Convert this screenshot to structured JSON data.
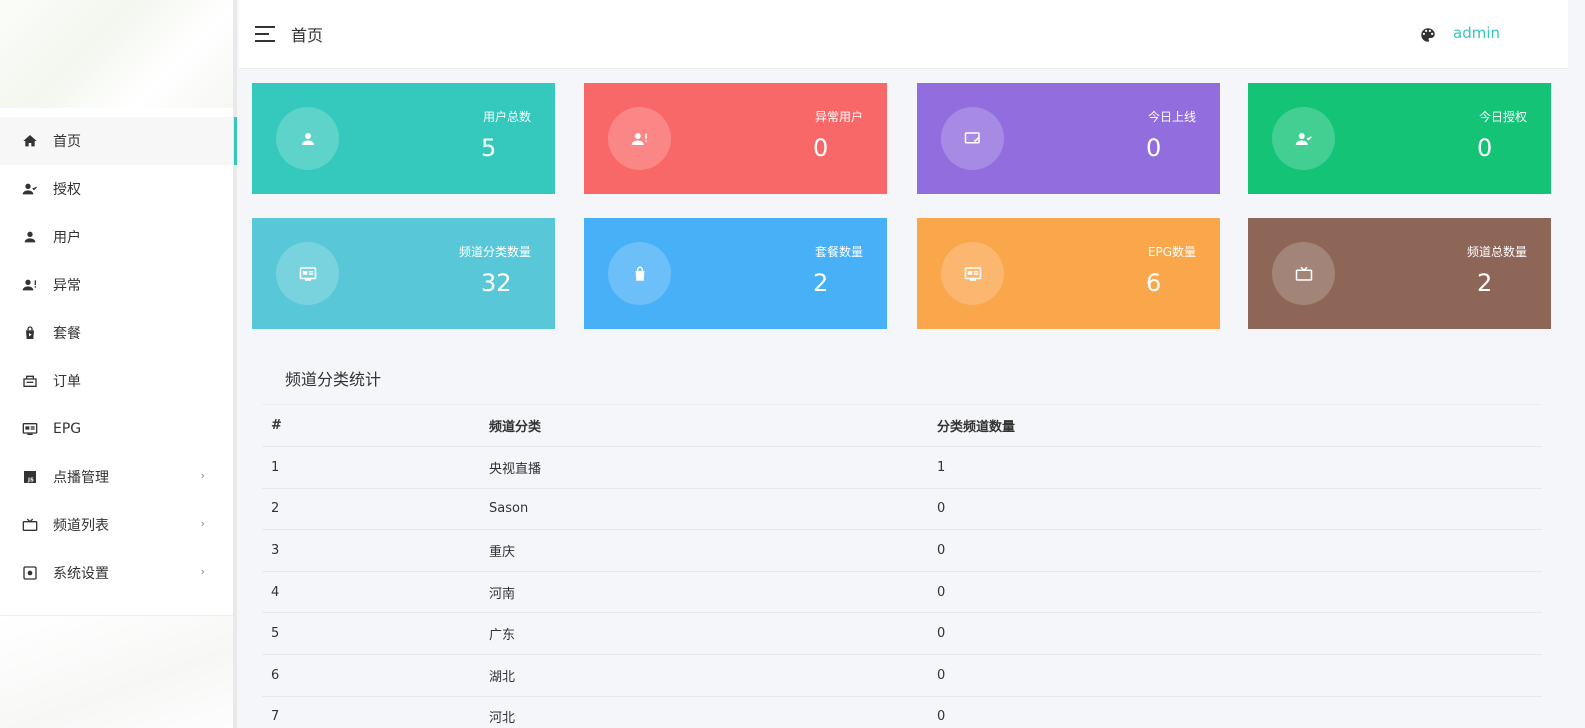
{
  "header": {
    "title": "首页",
    "user": "admin"
  },
  "sidebar": {
    "items": [
      {
        "label": "首页",
        "icon": "home-icon",
        "active": true,
        "has_children": false
      },
      {
        "label": "授权",
        "icon": "user-check-icon",
        "active": false,
        "has_children": false
      },
      {
        "label": "用户",
        "icon": "user-icon",
        "active": false,
        "has_children": false
      },
      {
        "label": "异常",
        "icon": "user-alert-icon",
        "active": false,
        "has_children": false
      },
      {
        "label": "套餐",
        "icon": "shopping-bag-icon",
        "active": false,
        "has_children": false
      },
      {
        "label": "订单",
        "icon": "order-icon",
        "active": false,
        "has_children": false
      },
      {
        "label": "EPG",
        "icon": "epg-icon",
        "active": false,
        "has_children": false
      },
      {
        "label": "点播管理",
        "icon": "js-icon",
        "active": false,
        "has_children": true
      },
      {
        "label": "频道列表",
        "icon": "tv-icon",
        "active": false,
        "has_children": true
      },
      {
        "label": "系统设置",
        "icon": "settings-icon",
        "active": false,
        "has_children": true
      }
    ],
    "chevron": "›"
  },
  "cards": [
    {
      "label": "用户总数",
      "value": "5",
      "color": "#35c9bd",
      "icon": "user-icon"
    },
    {
      "label": "异常用户",
      "value": "0",
      "color": "#f96868",
      "icon": "user-alert-icon"
    },
    {
      "label": "今日上线",
      "value": "0",
      "color": "#926dde",
      "icon": "screen-check-icon"
    },
    {
      "label": "今日授权",
      "value": "0",
      "color": "#15c377",
      "icon": "user-check-icon"
    },
    {
      "label": "频道分类数量",
      "value": "32",
      "color": "#58c8d8",
      "icon": "epg-icon"
    },
    {
      "label": "套餐数量",
      "value": "2",
      "color": "#48b0f7",
      "icon": "shopping-bag-icon"
    },
    {
      "label": "EPG数量",
      "value": "6",
      "color": "#faa64b",
      "icon": "epg-icon"
    },
    {
      "label": "频道总数量",
      "value": "2",
      "color": "#8d6658",
      "icon": "tv-icon"
    }
  ],
  "table": {
    "title": "频道分类统计",
    "headers": [
      "#",
      "频道分类",
      "分类频道数量"
    ],
    "rows": [
      [
        "1",
        "央视直播",
        "1"
      ],
      [
        "2",
        "Sason",
        "0"
      ],
      [
        "3",
        "重庆",
        "0"
      ],
      [
        "4",
        "河南",
        "0"
      ],
      [
        "5",
        "广东",
        "0"
      ],
      [
        "6",
        "湖北",
        "0"
      ],
      [
        "7",
        "河北",
        "0"
      ]
    ]
  }
}
